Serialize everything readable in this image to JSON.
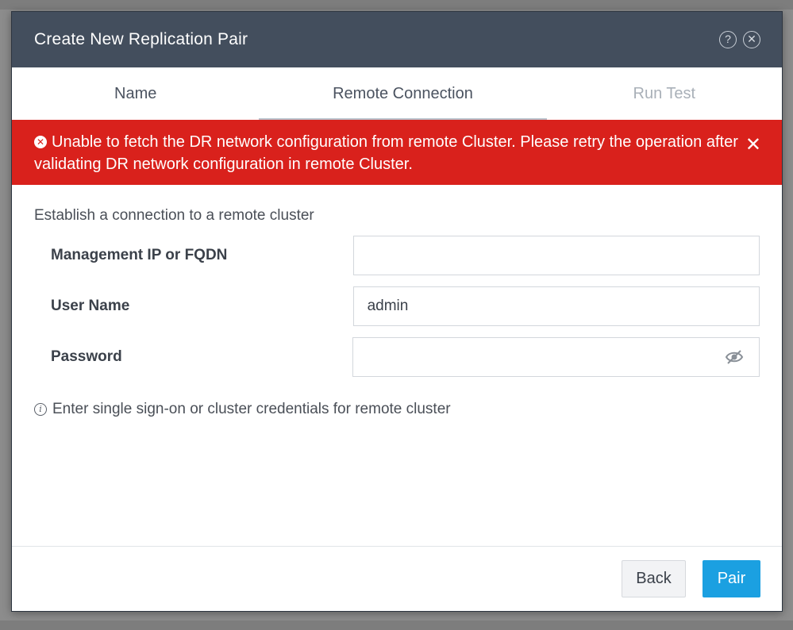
{
  "dialog": {
    "title": "Create New Replication Pair",
    "help_icon": "help-icon",
    "close_icon": "close-icon"
  },
  "tabs": [
    {
      "label": "Name",
      "state": "completed"
    },
    {
      "label": "Remote Connection",
      "state": "active"
    },
    {
      "label": "Run Test",
      "state": "disabled"
    }
  ],
  "error": {
    "message": "Unable to fetch the DR network configuration from remote Cluster. Please retry the operation after validating DR network configuration in remote Cluster.",
    "icon": "error-circle-icon",
    "close_glyph": "✕"
  },
  "form": {
    "intro": "Establish a connection to a remote cluster",
    "fields": {
      "management_ip": {
        "label": "Management IP or FQDN",
        "value": ""
      },
      "user_name": {
        "label": "User Name",
        "value": "admin"
      },
      "password": {
        "label": "Password",
        "value": "",
        "toggle_icon": "eye-slash-icon"
      }
    },
    "hint": "Enter single sign-on or cluster credentials for remote cluster"
  },
  "footer": {
    "back_label": "Back",
    "pair_label": "Pair"
  },
  "colors": {
    "header_bg": "#434e5d",
    "error_bg": "#d9211c",
    "primary_button": "#1ba0e1"
  }
}
